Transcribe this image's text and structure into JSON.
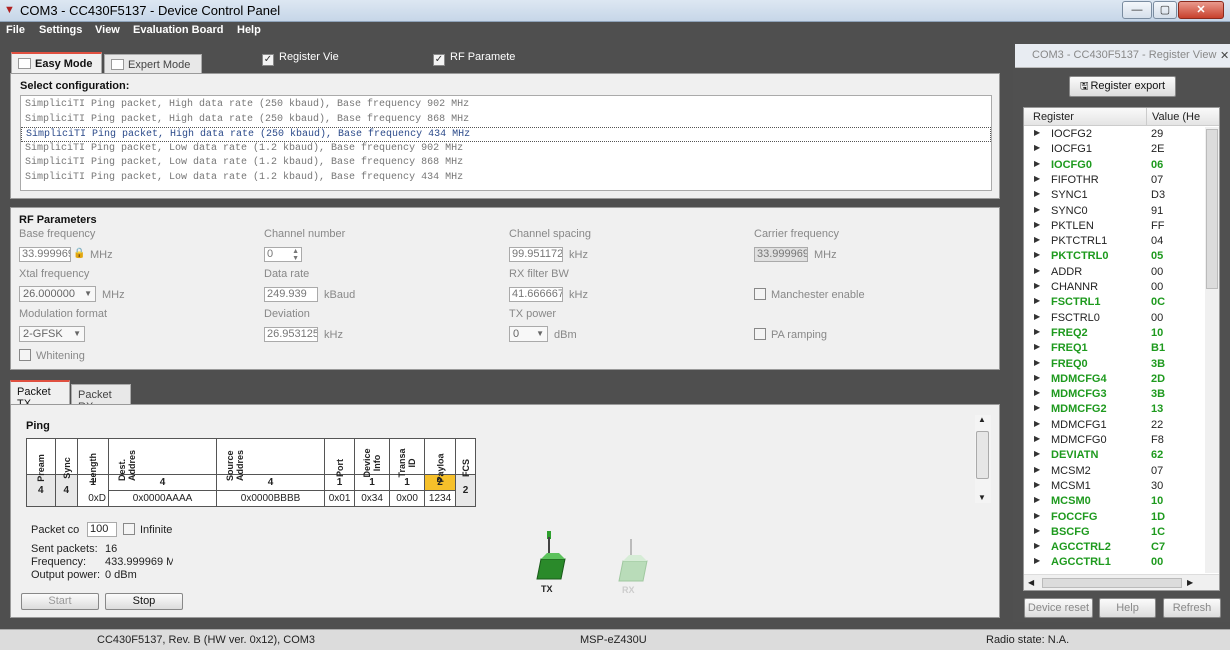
{
  "window": {
    "title": "COM3 - CC430F5137 - Device Control Panel"
  },
  "menu": [
    "File",
    "Settings",
    "View",
    "Evaluation Board",
    "Help"
  ],
  "tabs": {
    "easy": "Easy Mode",
    "expert": "Expert Mode"
  },
  "toggles": {
    "register_view": "Register Vie",
    "rf_params": "RF Paramete"
  },
  "config": {
    "title": "Select configuration:",
    "items": [
      "SimpliciTI Ping packet, High data rate (250 kbaud), Base frequency 902 MHz",
      "SimpliciTI Ping packet, High data rate (250 kbaud), Base frequency 868 MHz",
      "SimpliciTI Ping packet, High data rate (250 kbaud), Base frequency 434 MHz",
      "SimpliciTI Ping packet, Low data rate (1.2 kbaud), Base frequency 902 MHz",
      "SimpliciTI Ping packet, Low data rate (1.2 kbaud), Base frequency 868 MHz",
      "SimpliciTI Ping packet, Low data rate (1.2 kbaud), Base frequency 434 MHz"
    ]
  },
  "rf": {
    "title": "RF Parameters",
    "base_freq": {
      "label": "Base frequency",
      "value": "33.999969",
      "unit": "MHz"
    },
    "channel_num": {
      "label": "Channel number",
      "value": "0"
    },
    "channel_spacing": {
      "label": "Channel spacing",
      "value": "99.951172",
      "unit": "kHz"
    },
    "carrier_freq": {
      "label": "Carrier frequency",
      "value": "33.999969",
      "unit": "MHz"
    },
    "xtal_freq": {
      "label": "Xtal frequency",
      "value": "26.000000",
      "unit": "MHz"
    },
    "data_rate": {
      "label": "Data rate",
      "value": "249.939",
      "unit": "kBaud"
    },
    "rx_bw": {
      "label": "RX filter BW",
      "value": "41.666667",
      "unit": "kHz"
    },
    "manchester": "Manchester enable",
    "mod_format": {
      "label": "Modulation format",
      "value": "2-GFSK"
    },
    "deviation": {
      "label": "Deviation",
      "value": "26.953125",
      "unit": "kHz"
    },
    "tx_power": {
      "label": "TX power",
      "value": "0",
      "unit": "dBm"
    },
    "pa_ramping": "PA ramping",
    "whitening": "Whitening"
  },
  "packet_tabs": {
    "tx": "Packet TX",
    "rx": "Packet RX"
  },
  "ping": {
    "title": "Ping",
    "headers": [
      "Pream",
      "Sync",
      "Length",
      "Dest. Addres",
      "Source Addres",
      "Port",
      "Device Info",
      "Transa ID",
      "Payloa",
      "FCS"
    ],
    "sizes": [
      "4",
      "4",
      "1",
      "4",
      "4",
      "1",
      "1",
      "1",
      "2",
      "2"
    ],
    "values": [
      "",
      "",
      "0xD",
      "0x0000AAAA",
      "0x0000BBBB",
      "0x01",
      "0x34",
      "0x00",
      "1234",
      ""
    ]
  },
  "tx": {
    "packet_count_label": "Packet co",
    "packet_count": "100",
    "infinite": "Infinite",
    "sent_label": "Sent packets:",
    "sent": "16",
    "freq_label": "Frequency:",
    "freq": "433.999969 M",
    "power_label": "Output power:",
    "power": "0 dBm",
    "start": "Start",
    "stop": "Stop",
    "tx_icon": "TX",
    "rx_icon": "RX"
  },
  "register_panel": {
    "title": "COM3 - CC430F5137 - Register View",
    "export": "Register export",
    "col_register": "Register",
    "col_value": "Value (He",
    "rows": [
      {
        "name": "IOCFG2",
        "value": "29",
        "changed": false
      },
      {
        "name": "IOCFG1",
        "value": "2E",
        "changed": false
      },
      {
        "name": "IOCFG0",
        "value": "06",
        "changed": true
      },
      {
        "name": "FIFOTHR",
        "value": "07",
        "changed": false
      },
      {
        "name": "SYNC1",
        "value": "D3",
        "changed": false
      },
      {
        "name": "SYNC0",
        "value": "91",
        "changed": false
      },
      {
        "name": "PKTLEN",
        "value": "FF",
        "changed": false
      },
      {
        "name": "PKTCTRL1",
        "value": "04",
        "changed": false
      },
      {
        "name": "PKTCTRL0",
        "value": "05",
        "changed": true
      },
      {
        "name": "ADDR",
        "value": "00",
        "changed": false
      },
      {
        "name": "CHANNR",
        "value": "00",
        "changed": false
      },
      {
        "name": "FSCTRL1",
        "value": "0C",
        "changed": true
      },
      {
        "name": "FSCTRL0",
        "value": "00",
        "changed": false
      },
      {
        "name": "FREQ2",
        "value": "10",
        "changed": true
      },
      {
        "name": "FREQ1",
        "value": "B1",
        "changed": true
      },
      {
        "name": "FREQ0",
        "value": "3B",
        "changed": true
      },
      {
        "name": "MDMCFG4",
        "value": "2D",
        "changed": true
      },
      {
        "name": "MDMCFG3",
        "value": "3B",
        "changed": true
      },
      {
        "name": "MDMCFG2",
        "value": "13",
        "changed": true
      },
      {
        "name": "MDMCFG1",
        "value": "22",
        "changed": false
      },
      {
        "name": "MDMCFG0",
        "value": "F8",
        "changed": false
      },
      {
        "name": "DEVIATN",
        "value": "62",
        "changed": true
      },
      {
        "name": "MCSM2",
        "value": "07",
        "changed": false
      },
      {
        "name": "MCSM1",
        "value": "30",
        "changed": false
      },
      {
        "name": "MCSM0",
        "value": "10",
        "changed": true
      },
      {
        "name": "FOCCFG",
        "value": "1D",
        "changed": true
      },
      {
        "name": "BSCFG",
        "value": "1C",
        "changed": true
      },
      {
        "name": "AGCCTRL2",
        "value": "C7",
        "changed": true
      },
      {
        "name": "AGCCTRL1",
        "value": "00",
        "changed": true
      }
    ],
    "device_reset": "Device reset",
    "help": "Help",
    "refresh": "Refresh"
  },
  "status": {
    "device": "CC430F5137, Rev. B (HW ver. 0x12), COM3",
    "board": "MSP-eZ430U",
    "radio": "Radio state: N.A."
  },
  "colors": {
    "changed_register": "#1e9a1e",
    "payload_highlight": "#f6c02a",
    "tab_accent": "#e05040"
  }
}
